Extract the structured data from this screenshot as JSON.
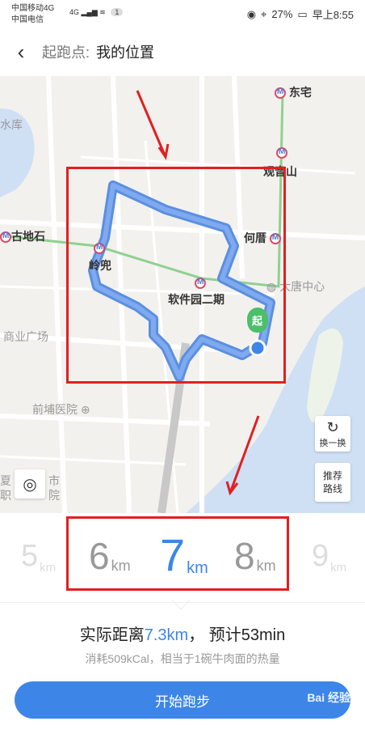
{
  "status": {
    "carrier1": "中国移动4G",
    "carrier2": "中国电信",
    "net": "4G",
    "badge": "1",
    "battery": "27%",
    "time": "早上8:55"
  },
  "header": {
    "label": "起跑点:",
    "value": "我的位置"
  },
  "map": {
    "labels": {
      "dongzhai": "东宅",
      "guanyinshan": "观音山",
      "gudishi": "古地石",
      "hecuo": "何厝",
      "lingdou": "岭兜",
      "datangzhongxin": "大唐中心",
      "ruanjianyuan": "软件园二期",
      "shangye": "商业广场",
      "qianpu": "前埔医院",
      "ku": "水库",
      "xia": "夏",
      "shi": "市",
      "zhi": "职",
      "yuan": "院"
    },
    "start_marker": "起",
    "refresh_label": "换一换",
    "recommend_label": "推荐路线"
  },
  "distances": [
    {
      "num": "5",
      "unit": "km"
    },
    {
      "num": "6",
      "unit": "km"
    },
    {
      "num": "7",
      "unit": "km"
    },
    {
      "num": "8",
      "unit": "km"
    },
    {
      "num": "9",
      "unit": "km"
    }
  ],
  "info": {
    "prefix": "实际距离",
    "distance": "7.3km",
    "mid": "， 预计",
    "time": "53min",
    "sub": "消耗509kCal，相当于1碗牛肉面的热量"
  },
  "start_button": "开始跑步",
  "watermark": "Bai 经验",
  "colors": {
    "accent": "#3d86e8",
    "annotation": "#e02020",
    "route": "#5b8fe0",
    "metro_green": "#8fd18f"
  }
}
